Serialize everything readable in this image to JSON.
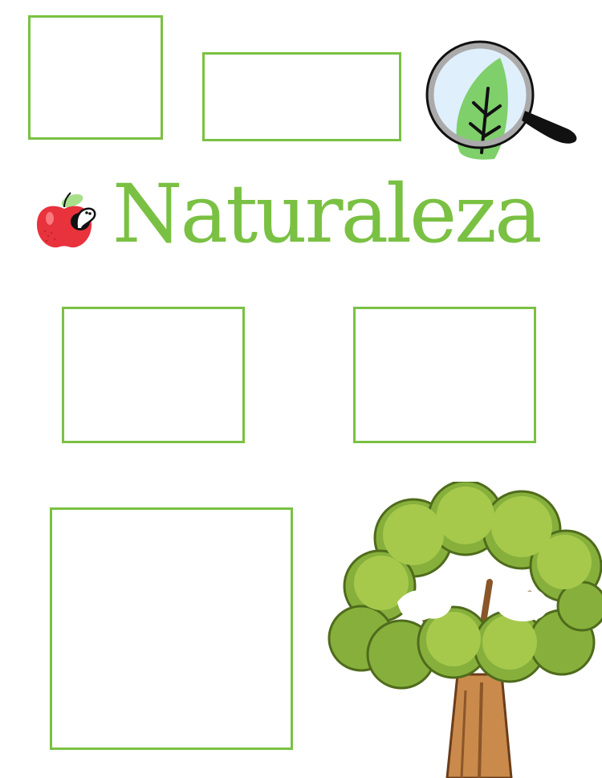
{
  "page": {
    "title": "Naturaleza",
    "title_color": "#7ac143",
    "frame_color": "#7ac143",
    "frames_count": 5
  },
  "decorations": {
    "magnifier": "magnifying-glass-leaf-icon",
    "apple": "apple-worm-icon",
    "tree": "tree-illustration"
  },
  "colors": {
    "leaf_green": "#7fcf6b",
    "apple_red": "#e8323c",
    "tree_foliage": "#86b03b",
    "tree_trunk": "#c98a4b"
  }
}
